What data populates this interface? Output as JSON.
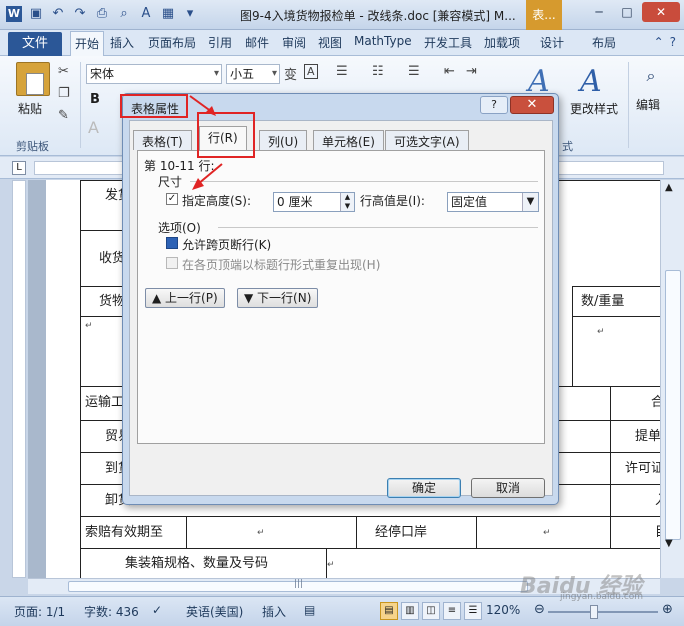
{
  "window": {
    "title": "图9-4入境货物报检单 - 改线条.doc [兼容模式] M...",
    "context_tab": "表..."
  },
  "ribbon": {
    "file_tab": "文件",
    "tabs": [
      "开始",
      "插入",
      "页面布局",
      "引用",
      "邮件",
      "审阅",
      "视图",
      "MathType",
      "开发工具",
      "加载项",
      "设计",
      "布局"
    ],
    "active_tab": "开始",
    "font_name": "宋体",
    "font_size": "小五",
    "paste_label": "粘贴",
    "clipboard_label": "剪贴板",
    "change_style_label": "更改样式",
    "edit_label": "编辑",
    "styles_group_tail": "式"
  },
  "document": {
    "rows": [
      {
        "c1": "发货"
      },
      {
        "c1": "收货"
      },
      {
        "c1": "货物",
        "c3": "数/重量"
      },
      {
        "c1": "↵",
        "c3": "↵"
      },
      {
        "c1": "运输工",
        "c4": "合"
      },
      {
        "c1": "贸易",
        "c4": "提单"
      },
      {
        "c1": "到货",
        "c4": "许可证"
      },
      {
        "c1": "卸货",
        "c4": "入"
      },
      {
        "c1": "索赔有效期至",
        "c2": "↵",
        "c3": "经停口岸",
        "c4": "↵",
        "c5": "目"
      },
      {
        "c1": "集装箱规格、数量及号码",
        "c2": "↵"
      }
    ]
  },
  "status": {
    "page": "页面: 1/1",
    "words": "字数: 436",
    "language": "英语(美国)",
    "insert_mode": "插入",
    "zoom": "120%"
  },
  "dialog": {
    "title": "表格属性",
    "tabs": [
      "表格(T)",
      "行(R)",
      "列(U)",
      "单元格(E)",
      "可选文字(A)"
    ],
    "active_tab": "行(R)",
    "row_range": "第 10-11 行:",
    "size_section": "尺寸",
    "specify_height_label": "指定高度(S):",
    "height_value": "0 厘米",
    "height_rule_label": "行高值是(I):",
    "height_rule_value": "固定值",
    "options_section": "选项(O)",
    "allow_break_label": "允许跨页断行(K)",
    "repeat_header_label": "在各页顶端以标题行形式重复出现(H)",
    "prev_row_button": "上一行(P)",
    "next_row_button": "下一行(N)",
    "ok_button": "确定",
    "cancel_button": "取消"
  },
  "watermark": {
    "text": "Baidu 经验",
    "sub": "jingyan.baidu.com"
  },
  "colors": {
    "annotation_red": "#e02424",
    "ribbon_blue": "#2b5797",
    "context_orange": "#d69a2e"
  }
}
